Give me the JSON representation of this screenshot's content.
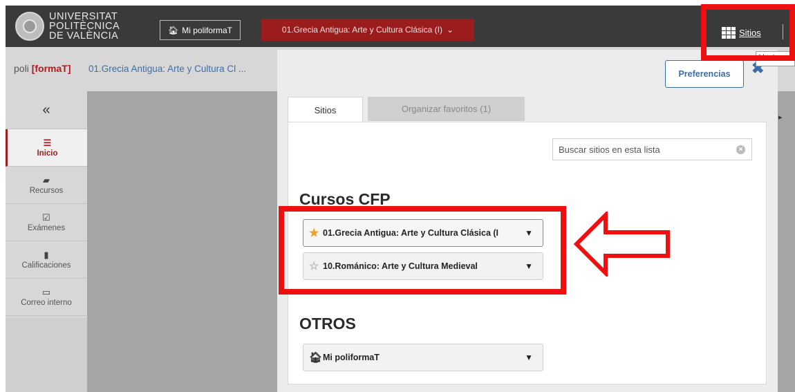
{
  "header": {
    "university_lines": [
      "UNIVERSITAT",
      "POLITÈCNICA",
      "DE VALÈNCIA"
    ],
    "home_button_label": "Mi poliformaT",
    "course_dropdown_label": "01.Grecia Antigua: Arte y Cultura Clásica (I)",
    "sitios_label": "Sitios",
    "tooltip_text": "Ver to"
  },
  "subbar": {
    "poli_prefix": "poli",
    "forma_label": "formaT",
    "breadcrumb": "01.Grecia Antigua: Arte y Cultura Cl ..."
  },
  "sidebar": {
    "collapse_symbol": "«",
    "items": [
      {
        "label": "Inicio",
        "icon": "list-icon"
      },
      {
        "label": "Recursos",
        "icon": "folder-icon"
      },
      {
        "label": "Exámenes",
        "icon": "checkbox-icon"
      },
      {
        "label": "Calificaciones",
        "icon": "book-icon"
      },
      {
        "label": "Correo interno",
        "icon": "inbox-icon"
      }
    ]
  },
  "modal": {
    "preferences_label": "Preferencias",
    "close_symbol": "✖",
    "tabs": [
      {
        "label": "Sitios",
        "active": true
      },
      {
        "label": "Organizar favoritos (1)",
        "active": false
      }
    ],
    "search_placeholder": "Buscar sitios en esta lista",
    "sections": [
      {
        "title": "Cursos CFP",
        "sites": [
          {
            "label": "01.Grecia Antigua: Arte y Cultura Clásica (I",
            "favorite": true
          },
          {
            "label": "10.Románico: Arte y Cultura Medieval",
            "favorite": false
          }
        ]
      },
      {
        "title": "OTROS",
        "sites": [
          {
            "label": "Mi poliformaT",
            "icon": "home-icon"
          }
        ]
      }
    ]
  },
  "colors": {
    "accent_red": "#9b1c1c",
    "link_blue": "#3b6ea8",
    "annotation_red": "#ee1010",
    "star_gold": "#f0a020"
  }
}
